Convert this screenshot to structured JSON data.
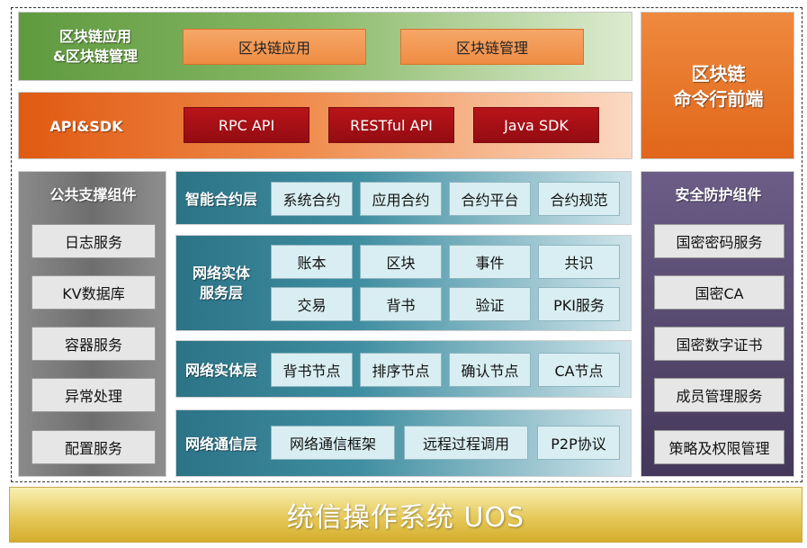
{
  "app_layer": {
    "title": "区块链应用\n&区块链管理",
    "items": [
      "区块链应用",
      "区块链管理"
    ]
  },
  "api_layer": {
    "title": "API&SDK",
    "items": [
      "RPC API",
      "RESTful API",
      "Java SDK"
    ]
  },
  "cmd_frontend": {
    "title": "区块链\n命令行前端"
  },
  "public_support": {
    "title": "公共支撑组件",
    "items": [
      "日志服务",
      "KV数据库",
      "容器服务",
      "异常处理",
      "配置服务"
    ]
  },
  "smart_contract": {
    "title": "智能合约层",
    "items": [
      "系统合约",
      "应用合约",
      "合约平台",
      "合约规范"
    ]
  },
  "entity_service": {
    "title": "网络实体\n服务层",
    "items": [
      "账本",
      "区块",
      "事件",
      "共识",
      "交易",
      "背书",
      "验证",
      "PKI服务"
    ]
  },
  "entity_layer": {
    "title": "网络实体层",
    "items": [
      "背书节点",
      "排序节点",
      "确认节点",
      "CA节点"
    ]
  },
  "comm_layer": {
    "title": "网络通信层",
    "items": [
      "网络通信框架",
      "远程过程调用",
      "P2P协议"
    ]
  },
  "security": {
    "title": "安全防护组件",
    "items": [
      "国密密码服务",
      "国密CA",
      "国密数字证书",
      "成员管理服务",
      "策略及权限管理"
    ]
  },
  "os": {
    "title": "统信操作系统 UOS"
  },
  "colors": {
    "green_band": "#86b764",
    "orange_band": "#ef8a4a",
    "red_button": "#b8141a",
    "teal_band": "#3f8ea1",
    "purple_panel": "#43385a",
    "grey_panel": "#7a7a7a",
    "os_gold": "#e6c95a"
  }
}
